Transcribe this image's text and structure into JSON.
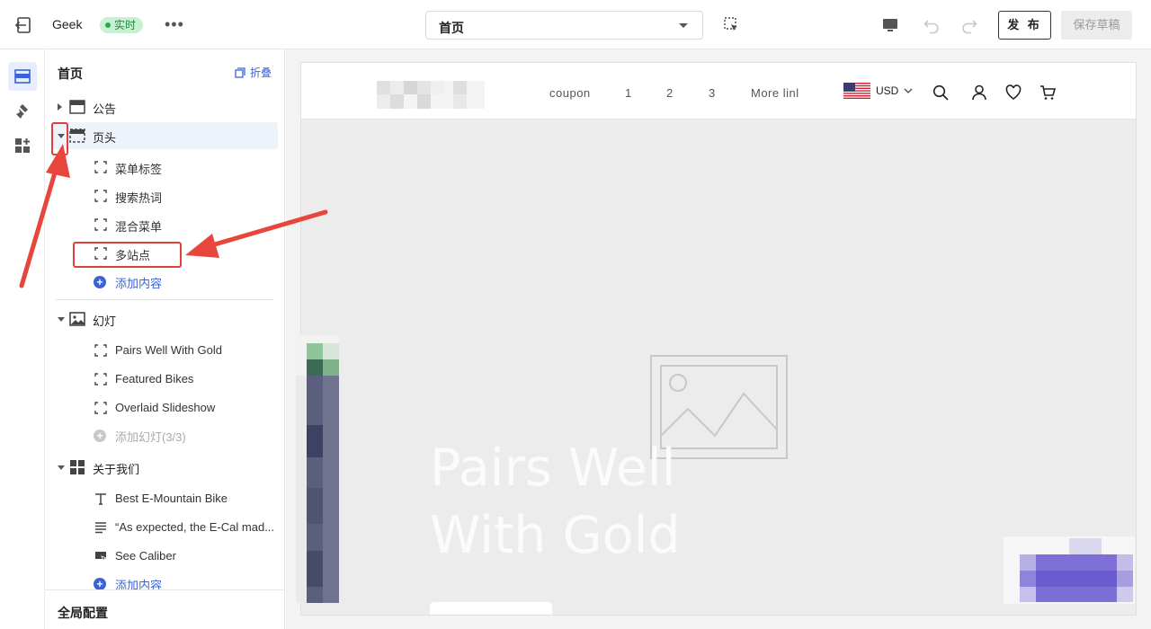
{
  "toolbar": {
    "store_name": "Geek",
    "live_badge": "实时",
    "more": "•••",
    "page_select_value": "首页",
    "publish_label": "发 布",
    "save_draft_label": "保存草稿"
  },
  "sidebar": {
    "title": "首页",
    "collapse_label": "折叠",
    "sections": [
      {
        "label": "公告",
        "expanded": false
      },
      {
        "label": "页头",
        "expanded": true,
        "selected": true,
        "children": [
          "菜单标签",
          "搜索热词",
          "混合菜单",
          "多站点"
        ],
        "add_label": "添加内容"
      },
      {
        "label": "幻灯",
        "expanded": true,
        "children": [
          "Pairs Well With Gold",
          "Featured Bikes",
          "Overlaid Slideshow"
        ],
        "add_label": "添加幻灯(3/3)"
      },
      {
        "label": "关于我们",
        "expanded": true,
        "children": [
          "Best E-Mountain Bike",
          "“As expected, the E-Cal mad...",
          "See Caliber"
        ],
        "add_label": "添加内容"
      }
    ],
    "global_config": "全局配置"
  },
  "preview": {
    "nav": [
      "coupon",
      "1",
      "2",
      "3",
      "More linl"
    ],
    "currency": "USD",
    "hero_title": "Pairs Well With Gold"
  },
  "colors": {
    "accent": "#3a63d8",
    "live_green": "#2ba84a",
    "annotation_red": "#e0403c"
  },
  "icons": [
    "exit-icon",
    "more-icon",
    "select-area-icon",
    "desktop-icon",
    "undo-icon",
    "redo-icon",
    "layout-icon",
    "theme-brush-icon",
    "apps-icon",
    "collapse-icon",
    "section-header-icon",
    "block-icon",
    "image-icon",
    "grid-icon",
    "text-icon",
    "paragraph-icon",
    "button-icon",
    "plus-icon",
    "us-flag-icon",
    "search-icon",
    "user-icon",
    "heart-icon",
    "cart-icon",
    "image-placeholder-icon"
  ]
}
